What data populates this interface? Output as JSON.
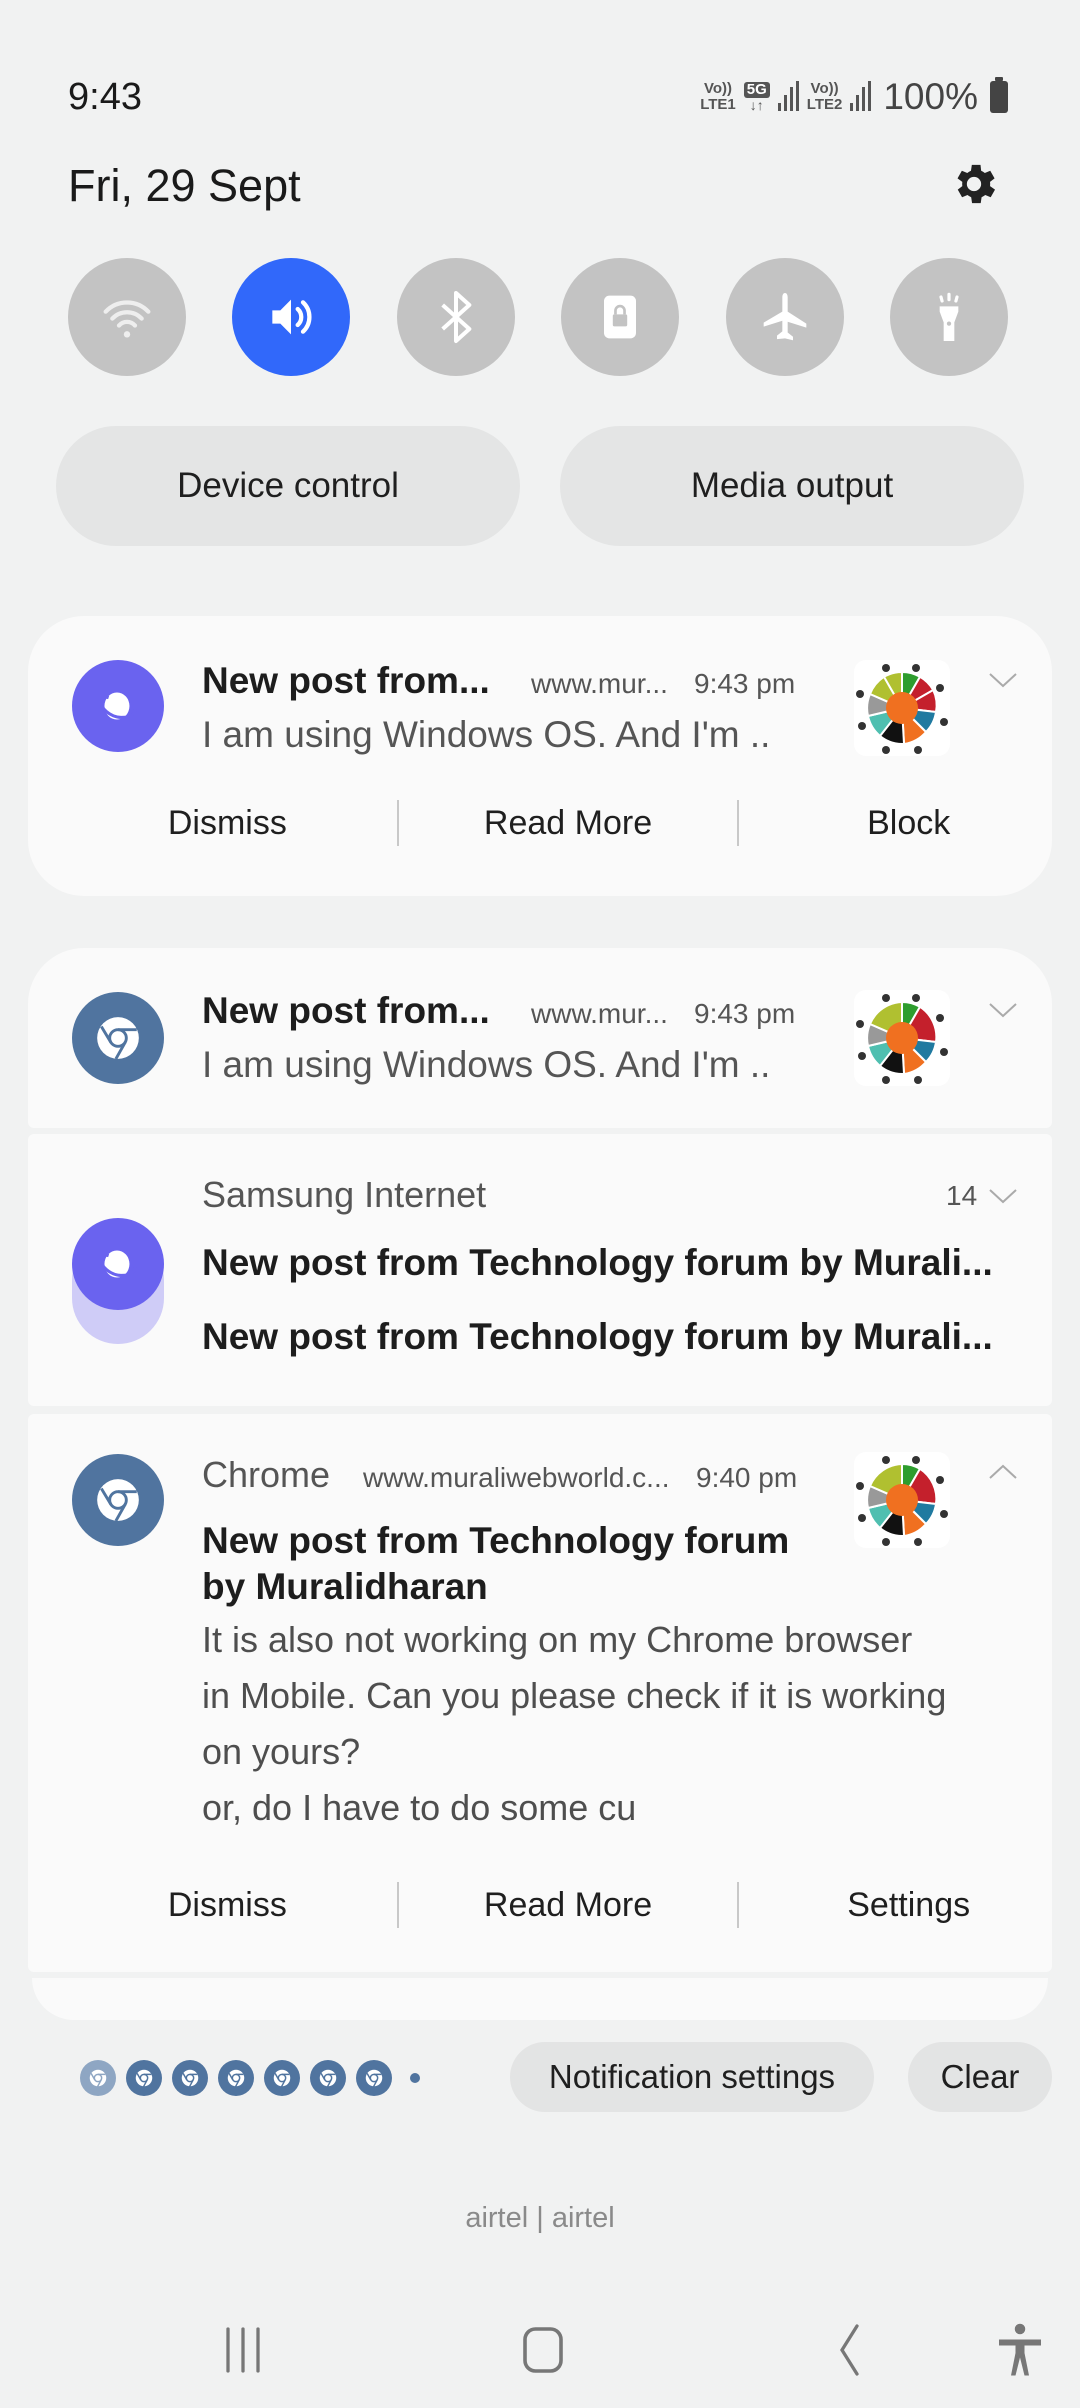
{
  "status_bar": {
    "time": "9:43",
    "sim1_label_top": "Vo))",
    "sim1_label_bottom": "LTE1",
    "network_type": "5G",
    "data_arrows": "↓↑",
    "sim2_label_top": "Vo))",
    "sim2_label_bottom": "LTE2",
    "battery": "100%"
  },
  "header": {
    "date": "Fri, 29 Sept",
    "settings_icon": "gear-icon"
  },
  "quick_toggles": [
    {
      "name": "Wi-Fi",
      "icon": "wifi-icon",
      "on": false
    },
    {
      "name": "Sound",
      "icon": "sound-icon",
      "on": true
    },
    {
      "name": "Bluetooth",
      "icon": "bluetooth-icon",
      "on": false
    },
    {
      "name": "Auto rotate lock",
      "icon": "rotation-lock-icon",
      "on": false
    },
    {
      "name": "Airplane mode",
      "icon": "airplane-icon",
      "on": false
    },
    {
      "name": "Flashlight",
      "icon": "flashlight-icon",
      "on": false
    }
  ],
  "buttons": {
    "device_control": "Device control",
    "media_output": "Media output"
  },
  "colors": {
    "accent": "#3168fa",
    "samsung_internet": "#6a63ef",
    "chrome": "#50749f"
  },
  "notifications": [
    {
      "app": "Samsung Internet",
      "title": "New post from...",
      "source": "www.mur...",
      "time": "9:43 pm",
      "text": "I am using Windows OS.  And I'm ..",
      "actions": [
        "Dismiss",
        "Read More",
        "Block"
      ]
    },
    {
      "app": "Chrome",
      "title": "New post from...",
      "source": "www.mur...",
      "time": "9:43 pm",
      "text": "I am using Windows OS.  And I'm .."
    },
    {
      "app": "Samsung Internet",
      "app_name": "Samsung Internet",
      "count": "14",
      "lines": [
        "New post from Technology forum by Murali...",
        "New post from Technology forum by Murali..."
      ]
    },
    {
      "app": "Chrome",
      "app_name": "Chrome",
      "source": "www.muraliwebworld.c...",
      "time": "9:40 pm",
      "title_lines": [
        "New post from Technology forum",
        "by Muralidharan"
      ],
      "body_lines": [
        "It is also not working on my Chrome browser",
        "in Mobile. Can you please check if it is working",
        "on yours?",
        "or, do I have to do some cu"
      ],
      "actions": [
        "Dismiss",
        "Read More",
        "Settings"
      ]
    }
  ],
  "footer": {
    "notification_settings": "Notification settings",
    "clear": "Clear",
    "overflow_icon_count": 7,
    "carrier": "airtel | airtel"
  },
  "nav_bar": [
    "recents-icon",
    "home-icon",
    "back-icon",
    "accessibility-icon"
  ]
}
